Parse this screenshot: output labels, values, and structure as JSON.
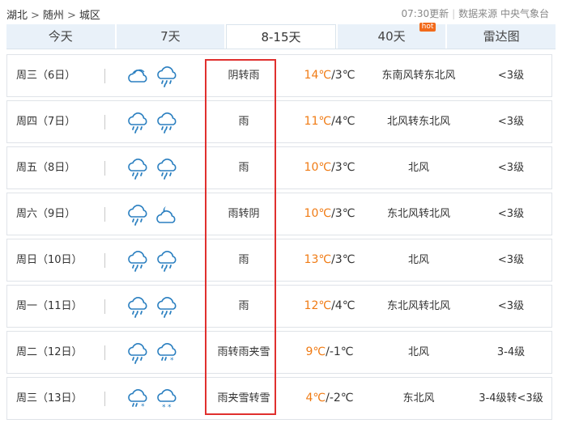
{
  "breadcrumb": {
    "province": "湖北",
    "city": "随州",
    "district": "城区",
    "separator": ">"
  },
  "meta": {
    "update_time": "07:30更新",
    "divider": "|",
    "source": "数据来源 中央气象台"
  },
  "tabs": [
    {
      "label": "今天",
      "active": false
    },
    {
      "label": "7天",
      "active": false
    },
    {
      "label": "8-15天",
      "active": true
    },
    {
      "label": "40天",
      "active": false,
      "badge": "hot"
    },
    {
      "label": "雷达图",
      "active": false
    }
  ],
  "colors": {
    "high_temp": "#f07b14",
    "highlight_box": "#e0302e",
    "tab_bg": "#e9f1f9",
    "hot_badge": "#f26a1b"
  },
  "forecast": [
    {
      "day": "周三（6日）",
      "icon1": "cloudy-icon",
      "icon2": "rain-icon",
      "desc": "阴转雨",
      "high": "14℃",
      "low": "/3℃",
      "wind": "东南风转东北风",
      "level": "<3级"
    },
    {
      "day": "周四（7日）",
      "icon1": "rain-icon",
      "icon2": "rain-icon",
      "desc": "雨",
      "high": "11℃",
      "low": "/4℃",
      "wind": "北风转东北风",
      "level": "<3级"
    },
    {
      "day": "周五（8日）",
      "icon1": "rain-icon",
      "icon2": "rain-icon",
      "desc": "雨",
      "high": "10℃",
      "low": "/3℃",
      "wind": "北风",
      "level": "<3级"
    },
    {
      "day": "周六（9日）",
      "icon1": "rain-icon",
      "icon2": "cloudy-night-icon",
      "desc": "雨转阴",
      "high": "10℃",
      "low": "/3℃",
      "wind": "东北风转北风",
      "level": "<3级"
    },
    {
      "day": "周日（10日）",
      "icon1": "rain-icon",
      "icon2": "rain-icon",
      "desc": "雨",
      "high": "13℃",
      "low": "/3℃",
      "wind": "北风",
      "level": "<3级"
    },
    {
      "day": "周一（11日）",
      "icon1": "rain-icon",
      "icon2": "rain-icon",
      "desc": "雨",
      "high": "12℃",
      "low": "/4℃",
      "wind": "东北风转北风",
      "level": "<3级"
    },
    {
      "day": "周二（12日）",
      "icon1": "rain-icon",
      "icon2": "sleet-icon",
      "desc": "雨转雨夹雪",
      "high": "9℃",
      "low": "/-1℃",
      "wind": "北风",
      "level": "3-4级"
    },
    {
      "day": "周三（13日）",
      "icon1": "sleet-icon",
      "icon2": "snow-icon",
      "desc": "雨夹雪转雪",
      "high": "4℃",
      "low": "/-2℃",
      "wind": "东北风",
      "level": "3-4级转<3级"
    }
  ]
}
